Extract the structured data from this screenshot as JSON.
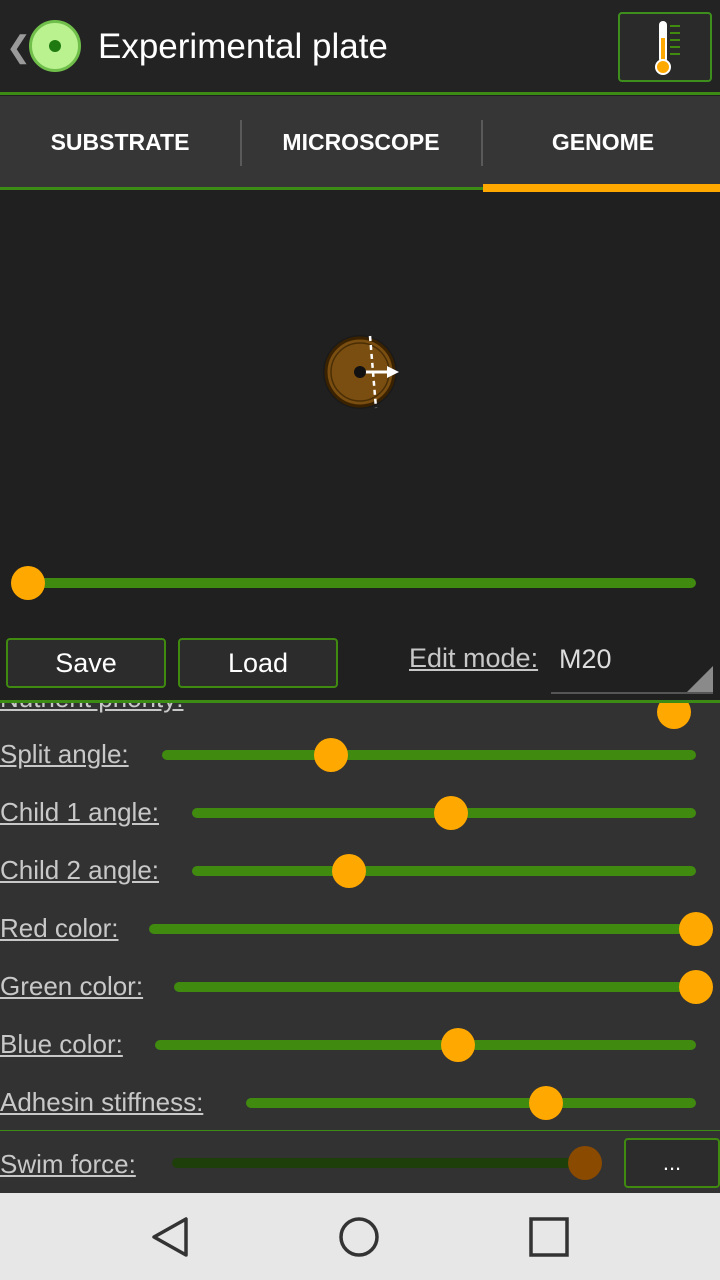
{
  "header": {
    "title": "Experimental plate"
  },
  "tabs": [
    {
      "label": "SUBSTRATE"
    },
    {
      "label": "MICROSCOPE"
    },
    {
      "label": "GENOME",
      "selected": true
    }
  ],
  "preview": {
    "timeline_value": 0
  },
  "actions": {
    "save_label": "Save",
    "load_label": "Load"
  },
  "edit_mode": {
    "label": "Edit mode:",
    "value": "M20"
  },
  "params": [
    {
      "label": "Nutrient priority:",
      "value": 0.98,
      "partial": true
    },
    {
      "label": "Split angle:",
      "value": 0.31
    },
    {
      "label": "Child 1 angle:",
      "value": 0.51
    },
    {
      "label": "Child 2 angle:",
      "value": 0.31
    },
    {
      "label": "Red color:",
      "value": 1.0
    },
    {
      "label": "Green color:",
      "value": 1.0
    },
    {
      "label": "Blue color:",
      "value": 0.56
    },
    {
      "label": "Adhesin stiffness:",
      "value": 0.67
    },
    {
      "label": "Swim force:",
      "value": 0.97,
      "disabled": true
    }
  ],
  "more_button": {
    "label": "..."
  },
  "colors": {
    "accent": "#ffa800",
    "track": "#3f8a0f",
    "cell": "#7a4e10"
  },
  "icons": [
    "back-chevron-icon",
    "app-logo-icon",
    "thermometer-icon",
    "dropdown-corner-icon",
    "nav-back-icon",
    "nav-home-icon",
    "nav-recents-icon"
  ]
}
